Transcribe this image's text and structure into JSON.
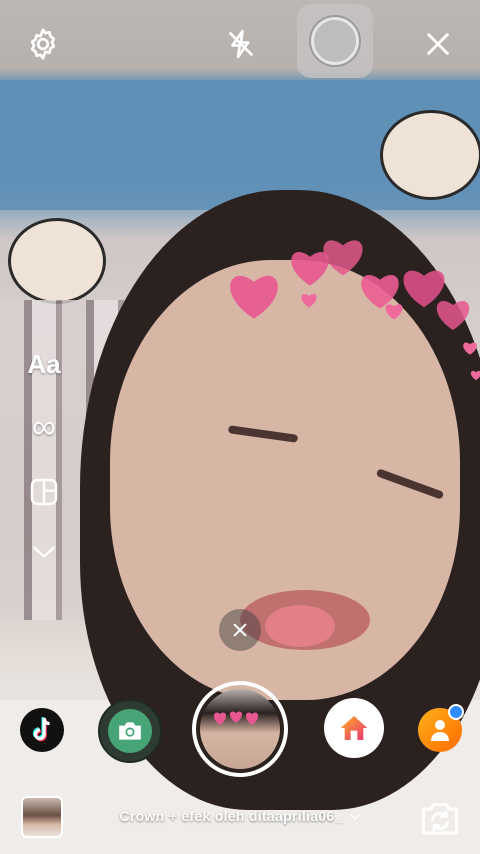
{
  "top_bar": {
    "settings_icon": "gear-icon",
    "flash_icon": "flash-off-icon",
    "close_icon": "close-icon"
  },
  "left_tools": {
    "text_label": "Aa",
    "boomerang_label": "∞",
    "layout_icon": "layout-icon",
    "more_icon": "chevron-down-icon"
  },
  "effects": {
    "items": [
      "tiktok-icon",
      "camera-icon",
      "home-icon",
      "person-icon"
    ]
  },
  "bottom_bar": {
    "effect_name": "Crown + efek oleh ditaaprilia06_",
    "flip_icon": "switch-camera-icon"
  },
  "colors": {
    "heart": "#e8578f",
    "accent_blue": "#2d8cff"
  }
}
